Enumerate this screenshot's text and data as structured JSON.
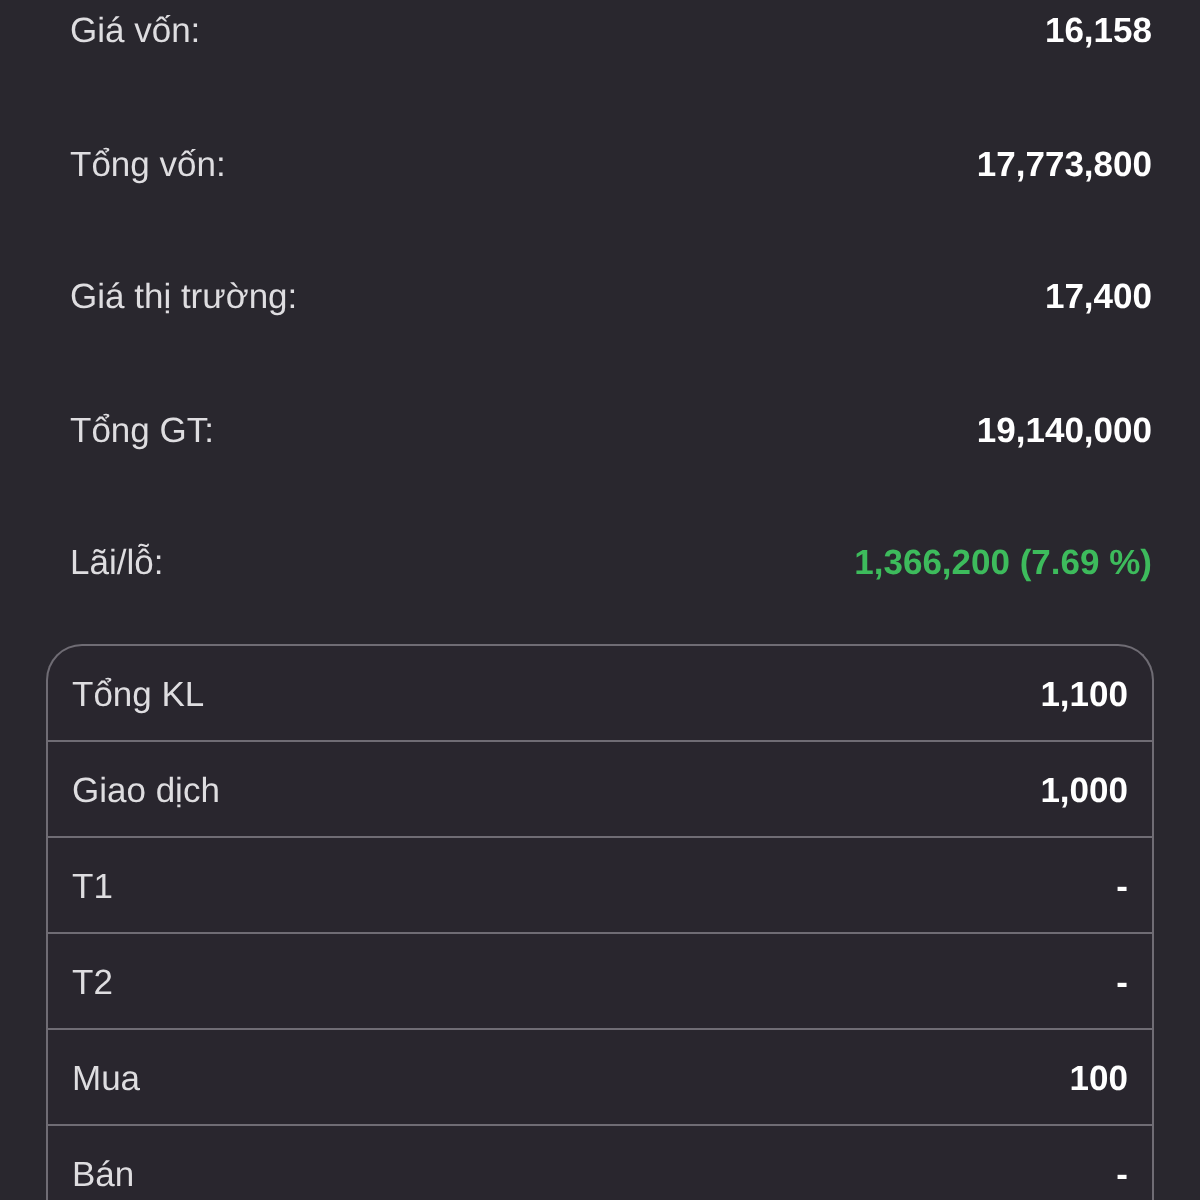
{
  "summary": [
    {
      "label": "Giá vốn:",
      "value": "16,158",
      "kind": "amount"
    },
    {
      "label": "Tổng vốn:",
      "value": "17,773,800",
      "kind": "amount"
    },
    {
      "label": "Giá thị trường:",
      "value": "17,400",
      "kind": "amount"
    },
    {
      "label": "Tổng GT:",
      "value": "19,140,000",
      "kind": "amount"
    },
    {
      "label": "Lãi/lỗ:",
      "value": "1,366,200 (7.69 %)",
      "kind": "profit"
    }
  ],
  "breakdown": [
    {
      "label": "Tổng KL",
      "value": "1,100"
    },
    {
      "label": "Giao dịch",
      "value": "1,000"
    },
    {
      "label": "T1",
      "value": "-"
    },
    {
      "label": "T2",
      "value": "-"
    },
    {
      "label": "Mua",
      "value": "100"
    },
    {
      "label": "Bán",
      "value": "-"
    }
  ]
}
